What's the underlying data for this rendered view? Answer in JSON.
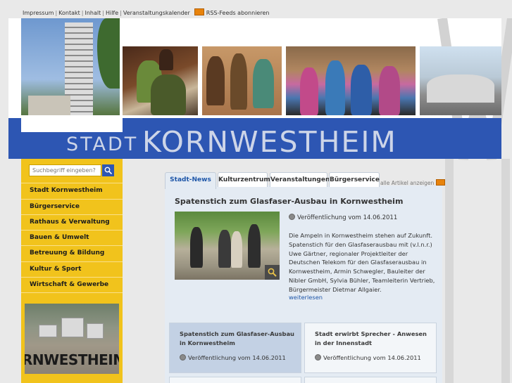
{
  "top_links": {
    "impressum": "Impressum",
    "kontakt": "Kontakt",
    "inhalt": "Inhalt",
    "hilfe": "Hilfe",
    "kalender": "Veranstaltungskalender",
    "rss_link": "RSS-Feeds",
    "rss_suffix": "abonnieren",
    "separator": "|"
  },
  "header": {
    "stadt": "STADT",
    "city": "KORNWESTHEIM"
  },
  "sidebar": {
    "search_placeholder": "Suchbegriff eingeben?",
    "items": [
      {
        "label": "Stadt Kornwestheim"
      },
      {
        "label": "Bürgerservice"
      },
      {
        "label": "Rathaus & Verwaltung"
      },
      {
        "label": "Bauen & Umwelt"
      },
      {
        "label": "Betreuung & Bildung"
      },
      {
        "label": "Kultur & Sport"
      },
      {
        "label": "Wirtschaft & Gewerbe"
      }
    ],
    "promo_text": "RNWESTHEIM"
  },
  "tabs": [
    {
      "label": "Stadt-News",
      "active": true
    },
    {
      "label": "Kulturzentrum"
    },
    {
      "label": "Veranstaltungen"
    },
    {
      "label": "Bürgerservice"
    }
  ],
  "all_articles": "alle Artikel anzeigen",
  "article": {
    "title": "Spatenstich zum Glasfaser-Ausbau in Kornwestheim",
    "date": "Veröffentlichung vom 14.06.2011",
    "body": "Die Ampeln in Kornwestheim stehen auf Zukunft. Spatenstich für den Glasfaserausbau mit (v.l.n.r.) Uwe Gärtner, regionaler Projektleiter der Deutschen Telekom für den Glasfaserausbau in Kornwestheim, Armin Schwegler, Bauleiter der Nibler GmbH, Sylvia Bühler, Teamleiterin Vertrieb, Bürgermeister Dietmar Allgaier.",
    "more": "weiterlesen"
  },
  "cards": [
    {
      "title": "Spatenstich zum Glasfaser-Ausbau in Kornwestheim",
      "date": "Veröffentlichung vom 14.06.2011"
    },
    {
      "title": "Stadt erwirbt Sprecher - Anwesen in der Innenstadt",
      "date": "Veröffentlichung vom 14.06.2011"
    }
  ],
  "colors": {
    "brand_blue": "#2d56b3",
    "sidebar_yellow": "#f1c31c",
    "link_blue": "#1e56a8",
    "rss_orange": "#e8830c"
  }
}
